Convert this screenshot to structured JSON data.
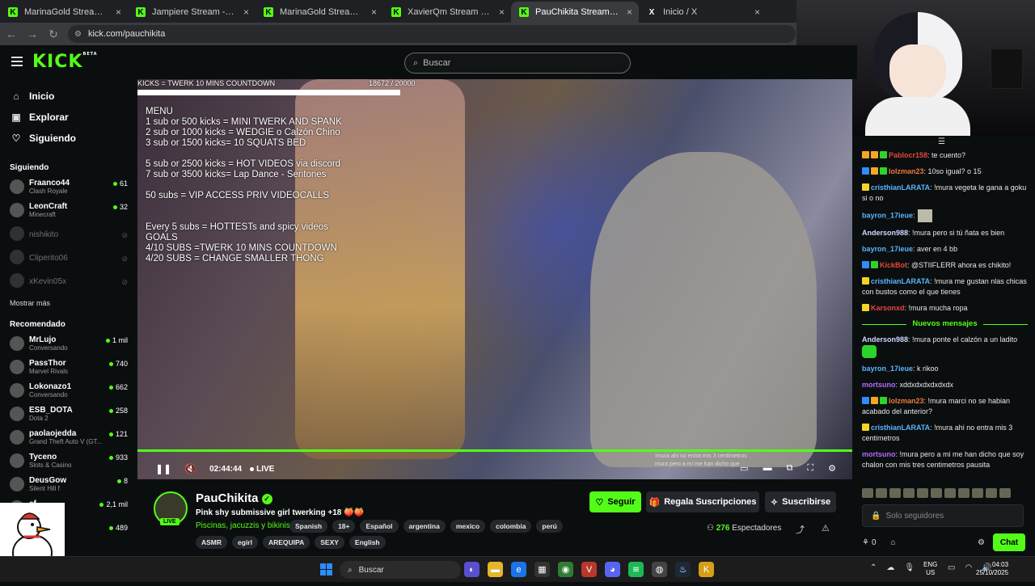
{
  "browser": {
    "tabs": [
      {
        "label": "MarinaGold Stream - Watch Live",
        "icon": "kick-icon"
      },
      {
        "label": "Jampiere Stream - Watch Live o",
        "icon": "kick-icon"
      },
      {
        "label": "MarinaGold Stream - Watch Live",
        "icon": "kick-icon"
      },
      {
        "label": "XavierQm Stream - Watch Live",
        "icon": "kick-icon"
      },
      {
        "label": "PauChikita Stream - Watch Live",
        "icon": "kick-icon",
        "active": true
      },
      {
        "label": "Inicio / X",
        "icon": "x-icon"
      }
    ],
    "url": "kick.com/pauchikita"
  },
  "header": {
    "logo": "KICK",
    "logo_sup": "BETA",
    "search_placeholder": "Buscar"
  },
  "sidebar": {
    "nav": [
      {
        "label": "Inicio",
        "icon": "home-icon"
      },
      {
        "label": "Explorar",
        "icon": "compass-icon"
      },
      {
        "label": "Siguiendo",
        "icon": "heart-icon"
      }
    ],
    "following_title": "Siguiendo",
    "following": [
      {
        "name": "Fraanco44",
        "game": "Clash Royale",
        "viewers": "61",
        "online": true
      },
      {
        "name": "LeonCraft",
        "game": "Minecraft",
        "viewers": "32",
        "online": true
      },
      {
        "name": "nishikito",
        "online": false
      },
      {
        "name": "Cliperito06",
        "online": false
      },
      {
        "name": "xKevin05x",
        "online": false
      }
    ],
    "show_more": "Mostrar más",
    "recommended_title": "Recomendado",
    "recommended": [
      {
        "name": "MrLujo",
        "game": "Conversando",
        "viewers": "1 mil"
      },
      {
        "name": "PassThor",
        "game": "Marvel Rivals",
        "viewers": "740"
      },
      {
        "name": "Lokonazo1",
        "game": "Conversando",
        "viewers": "662"
      },
      {
        "name": "ESB_DOTA",
        "game": "Dota 2",
        "viewers": "258"
      },
      {
        "name": "paolaojedda",
        "game": "Grand Theft Auto V (GT...",
        "viewers": "121"
      },
      {
        "name": "Tyceno",
        "game": "Slots & Casino",
        "viewers": "933"
      },
      {
        "name": "DeusGow",
        "game": "Silent Hill f",
        "viewers": "8"
      },
      {
        "name": "ef",
        "game": "ino",
        "viewers": "2,1 mil"
      },
      {
        "name": "",
        "game": "",
        "viewers": "489"
      }
    ]
  },
  "video": {
    "goal_label": "KICKS = TWERK 10 MINS COUNTDOWN",
    "goal_count": "18672 / 20000",
    "goal_progress": 0.93,
    "overlay_lines": [
      "MENU",
      "1 sub or 500 kicks = MINI TWERK AND SPANK",
      "2 sub or 1000 kicks = WEDGIE o Calzón Chino",
      "3 sub or 1500 kicks= 10 SQUATS BED",
      "",
      "5 sub or 2500 kicks = HOT VIDEOS via discord",
      "7 sub or 3500 kicks= Lap Dance - Sentones",
      "",
      "50 subs = VIP ACCESS PRIV VIDEOCALLS",
      "",
      "",
      "Every 5 subs = HOTTESTs and spicy videos",
      "GOALS",
      "4/10 SUBS =TWERK 10 MINS COUNTDOWN",
      "4/20 SUBS = CHANGE SMALLER THONG"
    ],
    "mini_chat": [
      "!mura ahi no entra mis 3 centimetros",
      "mura pero a mi me han dicho que"
    ],
    "time": "02:44:44",
    "live_label": "LIVE"
  },
  "stream": {
    "name": "PauChikita",
    "live_badge": "LIVE",
    "title": "Pink shy submissive girl twerking +18 🍑🍑",
    "category": "Piscinas, jacuzzis y bikinis",
    "tags_row1": [
      "Spanish",
      "18+",
      "Español",
      "argentina",
      "mexico",
      "colombia",
      "perú"
    ],
    "tags_row2": [
      "ASMR",
      "egirl",
      "AREQUIPA",
      "SEXY",
      "English"
    ],
    "follow_label": "Seguir",
    "gift_label": "Regala Suscripciones",
    "subscribe_label": "Suscribirse",
    "viewers": "276",
    "viewers_label": "Espectadores"
  },
  "chat": {
    "messages_before": [
      {
        "user": "Pablocr158",
        "color": "#e8453c",
        "text": ": te cuento?",
        "badges": [
          "#f5a623",
          "#f5a623",
          "#2bd42b"
        ]
      },
      {
        "user": "lolzman23",
        "color": "#e87a3c",
        "text": ": 10so igual? o 15",
        "badges": [
          "#2d8cff",
          "#f5a623",
          "#2bd42b"
        ]
      },
      {
        "user": "cristhianLARATA",
        "color": "#5ab4ff",
        "text": ": !mura vegeta le gana a goku si o no",
        "badges": [
          "#f5d523"
        ]
      },
      {
        "user": "bayron_17ieue",
        "color": "#5ab4ff",
        "text": ":",
        "emote": true
      },
      {
        "user": "Anderson988",
        "color": "#cfd8ff",
        "text": ": !mura pero si tú ñata es bien"
      },
      {
        "user": "bayron_17ieue",
        "color": "#5ab4ff",
        "text": ": aver en 4 bb"
      },
      {
        "user": "KickBot",
        "color": "#e8453c",
        "text": ": @STIIFLERR ahora es chikito!",
        "badges": [
          "#2d8cff",
          "#2bd42b"
        ]
      },
      {
        "user": "cristhianLARATA",
        "color": "#5ab4ff",
        "text": ": !mura me gustan nlas chicas con bustos como el que tienes",
        "badges": [
          "#f5d523"
        ]
      },
      {
        "user": "Karsonxd",
        "color": "#e8453c",
        "text": ": !mura mucha ropa",
        "badges": [
          "#f5d523"
        ]
      }
    ],
    "new_messages_label": "Nuevos mensajes",
    "messages_after": [
      {
        "user": "Anderson988",
        "color": "#cfd8ff",
        "text": ": !mura ponte el calzón a un ladito",
        "emote_green": true
      },
      {
        "user": "bayron_17ieue",
        "color": "#5ab4ff",
        "text": ": k rikoo"
      },
      {
        "user": "mortsuno",
        "color": "#b06cff",
        "text": ": xddxdxdxdxdxdx"
      },
      {
        "user": "lolzman23",
        "color": "#e87a3c",
        "text": ": !mura marci no se habian acabado del anterior?",
        "badges": [
          "#2d8cff",
          "#f5a623",
          "#2bd42b"
        ]
      },
      {
        "user": "cristhianLARATA",
        "color": "#5ab4ff",
        "text": ": !mura ahi no entra mis 3 centimetros",
        "badges": [
          "#f5d523"
        ]
      },
      {
        "user": "mortsuno",
        "color": "#b06cff",
        "text": ": !mura pero a mi me han dicho que soy chalon con mis tres centimetros pausita"
      }
    ],
    "input_placeholder": "Solo seguidores",
    "points": "0",
    "send_label": "Chat"
  },
  "taskbar": {
    "search_label": "Buscar",
    "lang_line1": "ENG",
    "lang_line2": "US",
    "time": "04:03",
    "date": "25/10/2025"
  }
}
